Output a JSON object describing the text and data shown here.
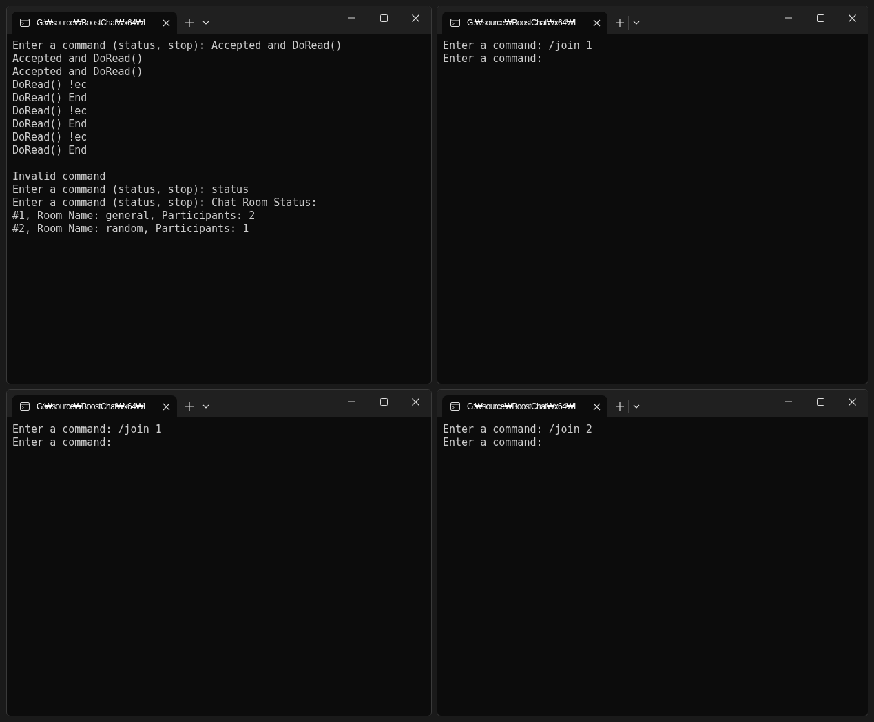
{
  "windows": [
    {
      "tab": {
        "title": "G:₩source₩BoostChat₩x64₩I",
        "selected": true
      },
      "blocks": [
        [
          "Enter a command (status, stop): Accepted and DoRead()",
          "Accepted and DoRead()",
          "Accepted and DoRead()",
          "DoRead() !ec",
          "DoRead() End",
          "DoRead() !ec",
          "DoRead() End",
          "DoRead() !ec",
          "DoRead() End"
        ],
        [
          "Invalid command",
          "Enter a command (status, stop): status",
          "Enter a command (status, stop): Chat Room Status:",
          "#1, Room Name: general, Participants: 2",
          "#2, Room Name: random, Participants: 1"
        ]
      ]
    },
    {
      "tab": {
        "title": "G:₩source₩BoostChat₩x64₩I",
        "selected": true
      },
      "blocks": [
        [
          "Enter a command: /join 1",
          "Enter a command:"
        ]
      ]
    },
    {
      "tab": {
        "title": "G:₩source₩BoostChat₩x64₩I",
        "selected": true
      },
      "blocks": [
        [
          "Enter a command: /join 1",
          "Enter a command:"
        ]
      ]
    },
    {
      "tab": {
        "title": "G:₩source₩BoostChat₩x64₩I",
        "selected": true
      },
      "blocks": [
        [
          "Enter a command: /join 2",
          "Enter a command:"
        ]
      ]
    }
  ]
}
